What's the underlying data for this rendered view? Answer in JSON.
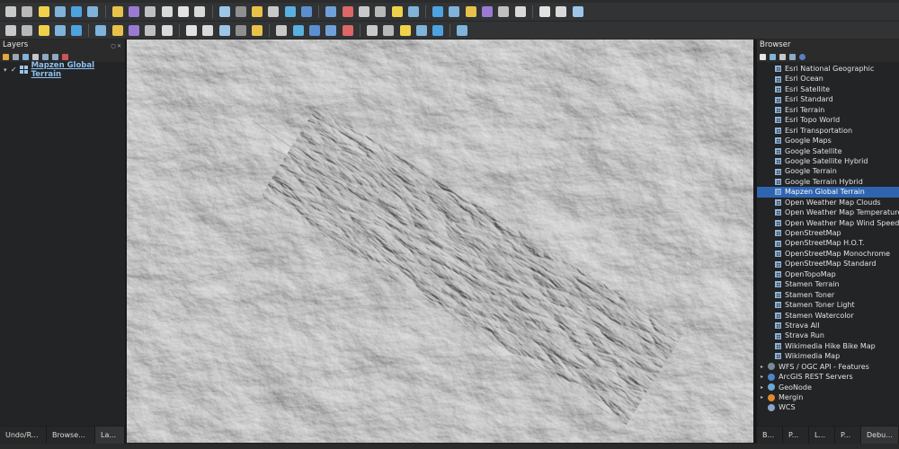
{
  "toolbar_row1": [
    "new-project",
    "open-project",
    "save-project",
    "save-as",
    "print-layout",
    "layout-manager",
    "pan",
    "pan-to-selection",
    "zoom-in",
    "zoom-out",
    "zoom-full",
    "zoom-selection",
    "zoom-layer",
    "zoom-native",
    "zoom-last",
    "zoom-next",
    "new-map-view",
    "new-3d-view",
    "bookmarks",
    "show-bookmarks",
    "refresh",
    "identify",
    "actions",
    "select-features",
    "field-calc",
    "attribute-table",
    "statistics",
    "measure",
    "map-tips",
    "annotation",
    "text-annotation",
    "digitize",
    "gps"
  ],
  "toolbar_row2": [
    "edit-toggle",
    "save-edits",
    "add-feature",
    "vertex-tool",
    "delete",
    "cut",
    "copy",
    "paste",
    "undo",
    "redo",
    "label-pin",
    "label-show",
    "label-move",
    "label-rotate",
    "label-change",
    "diagram",
    "snap",
    "trace",
    "avoid",
    "topology",
    "style-manager",
    "processing",
    "python-console",
    "plugins",
    "grass",
    "help"
  ],
  "layers_panel": {
    "title": "Layers",
    "layer": {
      "name": "Mapzen Global Terrain",
      "checked": "✓"
    }
  },
  "browser_panel": {
    "title": "Browser",
    "xyz_tiles": [
      "Esri National Geographic",
      "Esri Ocean",
      "Esri Satellite",
      "Esri Standard",
      "Esri Terrain",
      "Esri Topo World",
      "Esri Transportation",
      "Google Maps",
      "Google Satellite",
      "Google Satellite Hybrid",
      "Google Terrain",
      "Google Terrain Hybrid",
      "Mapzen Global Terrain",
      "Open Weather Map Clouds",
      "Open Weather Map Temperature",
      "Open Weather Map Wind Speed",
      "OpenStreetMap",
      "OpenStreetMap H.O.T.",
      "OpenStreetMap Monochrome",
      "OpenStreetMap Standard",
      "OpenTopoMap",
      "Stamen Terrain",
      "Stamen Toner",
      "Stamen Toner Light",
      "Stamen Watercolor",
      "Strava All",
      "Strava Run",
      "Wikimedia Hike Bike Map",
      "Wikimedia Map"
    ],
    "selected": "Mapzen Global Terrain",
    "groups": [
      {
        "label": "WFS / OGC API - Features",
        "color": "#7b8a99"
      },
      {
        "label": "ArcGIS REST Servers",
        "color": "#4c86c8"
      },
      {
        "label": "GeoNode",
        "color": "#6aa9d6"
      },
      {
        "label": "Mergin",
        "color": "#e08a2c"
      },
      {
        "label": "WCS",
        "color": "#8aa4c8"
      }
    ]
  },
  "tabs_left": [
    "Undo/R...",
    "Browse...",
    "La..."
  ],
  "tabs_right": [
    "B...",
    "P...",
    "L...",
    "P...",
    "Debu..."
  ],
  "colors": {
    "selection": "#2f65b0",
    "link": "#8ec1f0",
    "hillshade": "#c9c9c9"
  }
}
